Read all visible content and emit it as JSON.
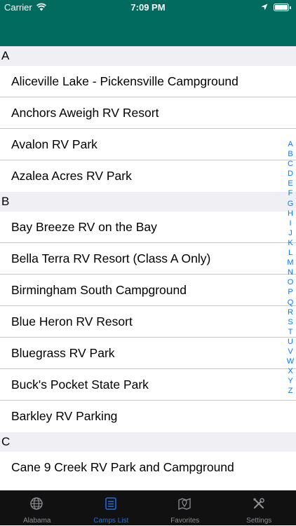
{
  "status_bar": {
    "carrier": "Carrier",
    "time": "7:09 PM"
  },
  "sections": [
    {
      "letter": "A",
      "items": [
        "Aliceville Lake - Pickensville Campground",
        "Anchors Aweigh RV Resort",
        "Avalon RV Park",
        "Azalea Acres RV Park"
      ]
    },
    {
      "letter": "B",
      "items": [
        "Bay Breeze RV on the Bay",
        "Bella Terra RV Resort (Class A Only)",
        "Birmingham South Campground",
        "Blue Heron RV Resort",
        "Bluegrass RV Park",
        "Buck's Pocket State Park",
        "Barkley RV Parking"
      ]
    },
    {
      "letter": "C",
      "items": [
        "Cane 9 Creek RV Park and Campground"
      ]
    }
  ],
  "index_letters": [
    "A",
    "B",
    "C",
    "D",
    "E",
    "F",
    "G",
    "H",
    "I",
    "J",
    "K",
    "L",
    "M",
    "N",
    "O",
    "P",
    "Q",
    "R",
    "S",
    "T",
    "U",
    "V",
    "W",
    "X",
    "Y",
    "Z"
  ],
  "tabs": [
    {
      "label": "Alabama",
      "icon": "globe-icon"
    },
    {
      "label": "Camps List",
      "icon": "list-icon"
    },
    {
      "label": "Favorites",
      "icon": "map-pin-icon"
    },
    {
      "label": "Settings",
      "icon": "tools-icon"
    }
  ],
  "colors": {
    "header": "#006b5e",
    "accent": "#1f6fe5",
    "index": "#007aff",
    "tab_bar": "#111111"
  }
}
